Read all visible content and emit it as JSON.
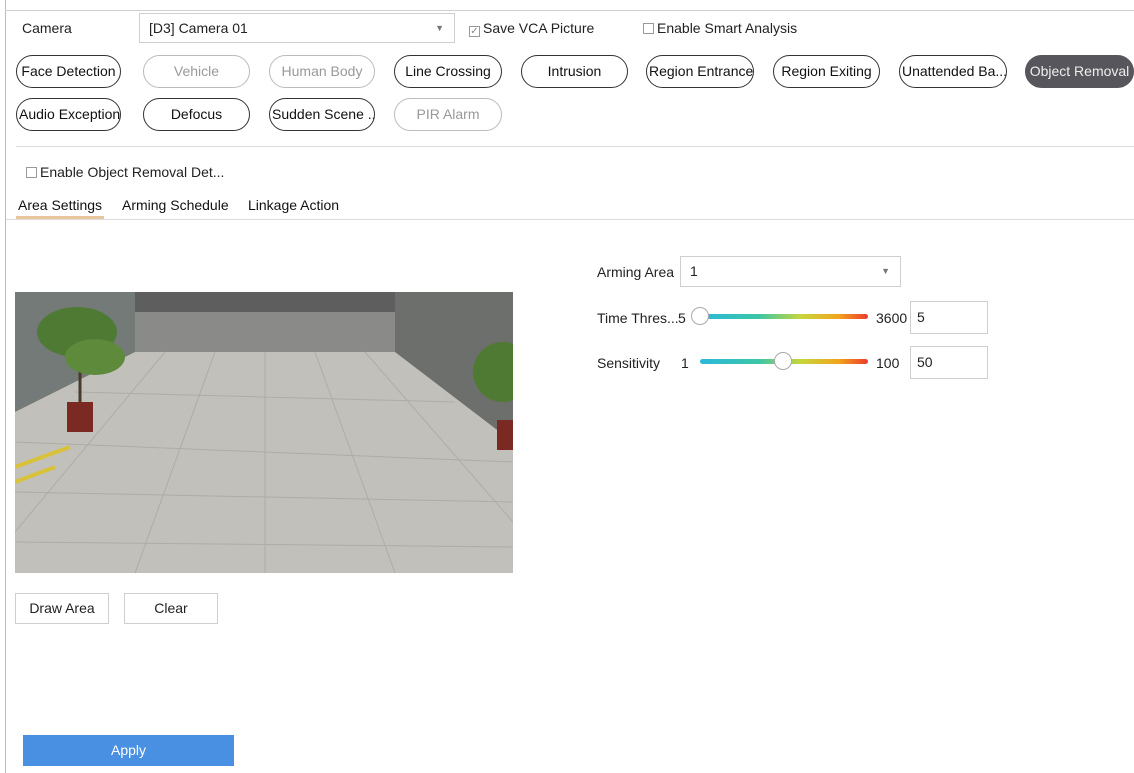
{
  "header": {
    "camera_label": "Camera",
    "camera_value": "[D3] Camera 01",
    "save_vca_label": "Save VCA Picture",
    "save_vca_checked": true,
    "smart_analysis_label": "Enable Smart Analysis",
    "smart_analysis_checked": false
  },
  "detections": {
    "row1": [
      {
        "label": "Face Detection",
        "state": "enabled"
      },
      {
        "label": "Vehicle",
        "state": "disabled"
      },
      {
        "label": "Human Body",
        "state": "disabled"
      },
      {
        "label": "Line Crossing",
        "state": "enabled"
      },
      {
        "label": "Intrusion",
        "state": "enabled"
      },
      {
        "label": "Region Entrance",
        "state": "enabled"
      },
      {
        "label": "Region Exiting",
        "state": "enabled"
      },
      {
        "label": "Unattended Ba...",
        "state": "enabled"
      },
      {
        "label": "Object Removal",
        "state": "active"
      }
    ],
    "row2": [
      {
        "label": "Audio Exception",
        "state": "enabled"
      },
      {
        "label": "Defocus",
        "state": "enabled"
      },
      {
        "label": "Sudden Scene ...",
        "state": "enabled"
      },
      {
        "label": "PIR Alarm",
        "state": "disabled"
      }
    ]
  },
  "enable_object_removal": {
    "label": "Enable Object Removal Det...",
    "checked": false
  },
  "tabs": [
    {
      "label": "Area Settings",
      "active": true
    },
    {
      "label": "Arming Schedule",
      "active": false
    },
    {
      "label": "Linkage Action",
      "active": false
    }
  ],
  "settings": {
    "arming_area_label": "Arming Area",
    "arming_area_value": "1",
    "time_threshold": {
      "label": "Time Thres...",
      "min": "5",
      "max": "3600",
      "value": "5"
    },
    "sensitivity": {
      "label": "Sensitivity",
      "min": "1",
      "max": "100",
      "value": "50"
    }
  },
  "actions": {
    "draw_area": "Draw Area",
    "clear": "Clear",
    "apply": "Apply"
  },
  "colors": {
    "apply_button": "#4a90e2",
    "active_pill": "#57565c",
    "tab_underline": "#e9c79e"
  },
  "icons": {
    "dropdown": "caret-down-icon",
    "checkbox": "checkbox-icon"
  }
}
